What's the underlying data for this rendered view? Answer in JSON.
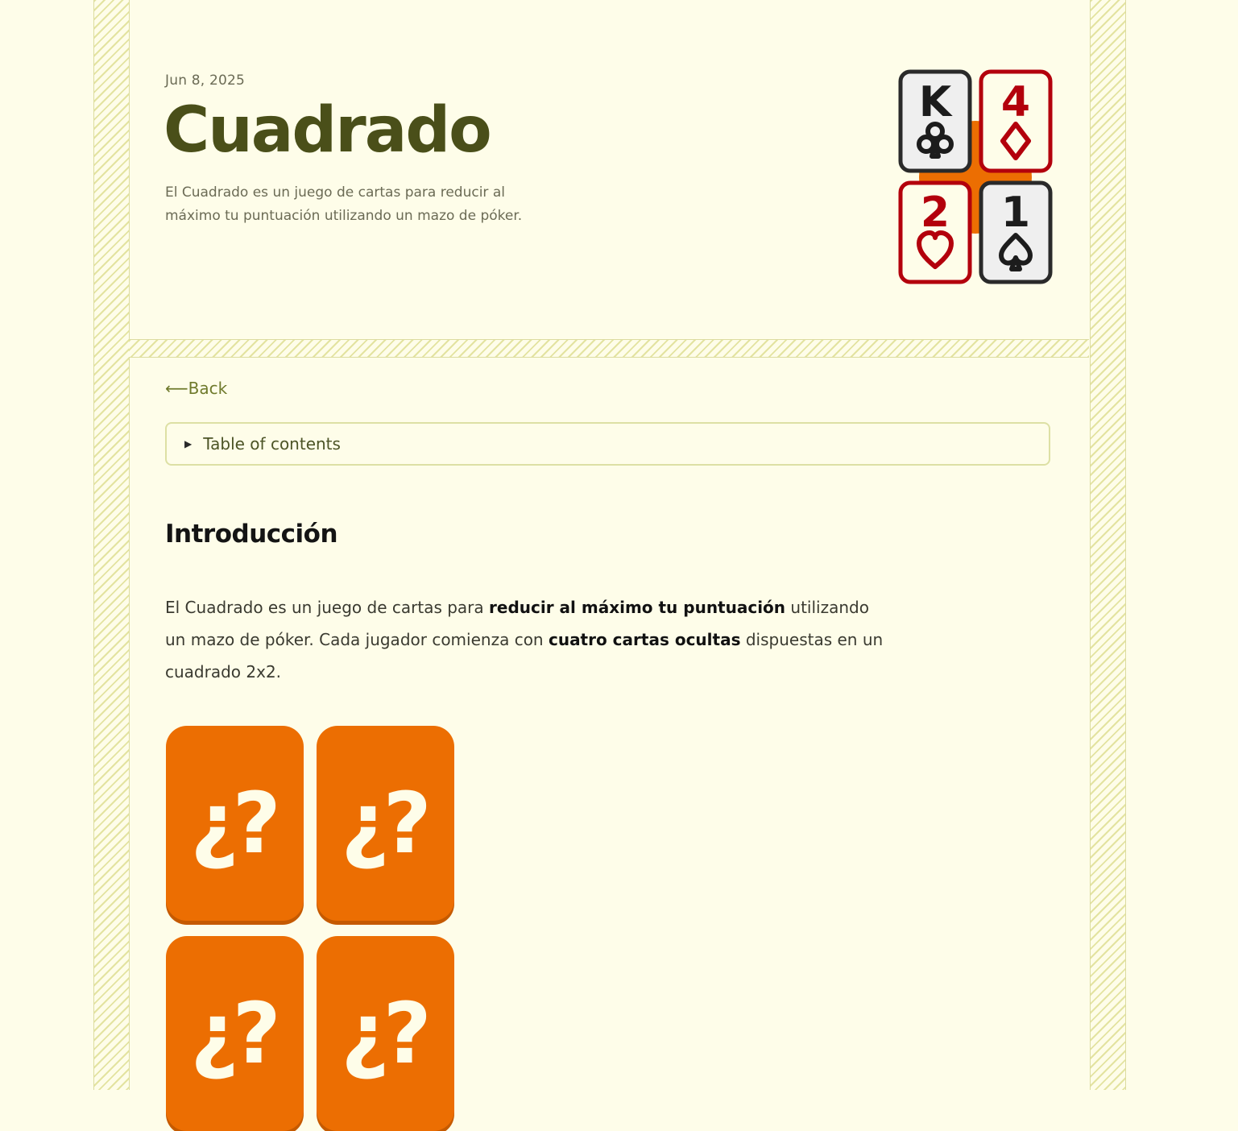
{
  "post": {
    "date": "Jun 8, 2025",
    "title": "Cuadrado",
    "summary": "El Cuadrado es un juego de cartas para reducir al máximo tu puntuación utilizando un mazo de póker."
  },
  "logo": {
    "cards": [
      {
        "rank": "K",
        "suit": "clubs",
        "color": "#1c1c1c"
      },
      {
        "rank": "4",
        "suit": "diamonds",
        "color": "#b3000c"
      },
      {
        "rank": "2",
        "suit": "hearts",
        "color": "#b3000c"
      },
      {
        "rank": "1",
        "suit": "spades",
        "color": "#1c1c1c"
      }
    ],
    "accent": "#ec6e02"
  },
  "nav": {
    "back_arrow": "⟵",
    "back_label": "Back"
  },
  "toc": {
    "caret_icon": "triangle-right-icon",
    "label": "Table of contents"
  },
  "content": {
    "heading": "Introducción",
    "intro": {
      "t1": "El Cuadrado es un juego de cartas para ",
      "b1": "reducir al máximo tu puntuación",
      "t2": " utilizando un mazo de póker. Cada jugador comienza con ",
      "b2": "cuatro cartas ocultas",
      "t3": " dispuestas en un cuadrado 2x2."
    },
    "hidden_card_glyph": "¿?"
  },
  "colors": {
    "background": "#fefde9",
    "title": "#4a4f19",
    "stripe": "#e3e3a0",
    "card_orange": "#ec6e02"
  }
}
